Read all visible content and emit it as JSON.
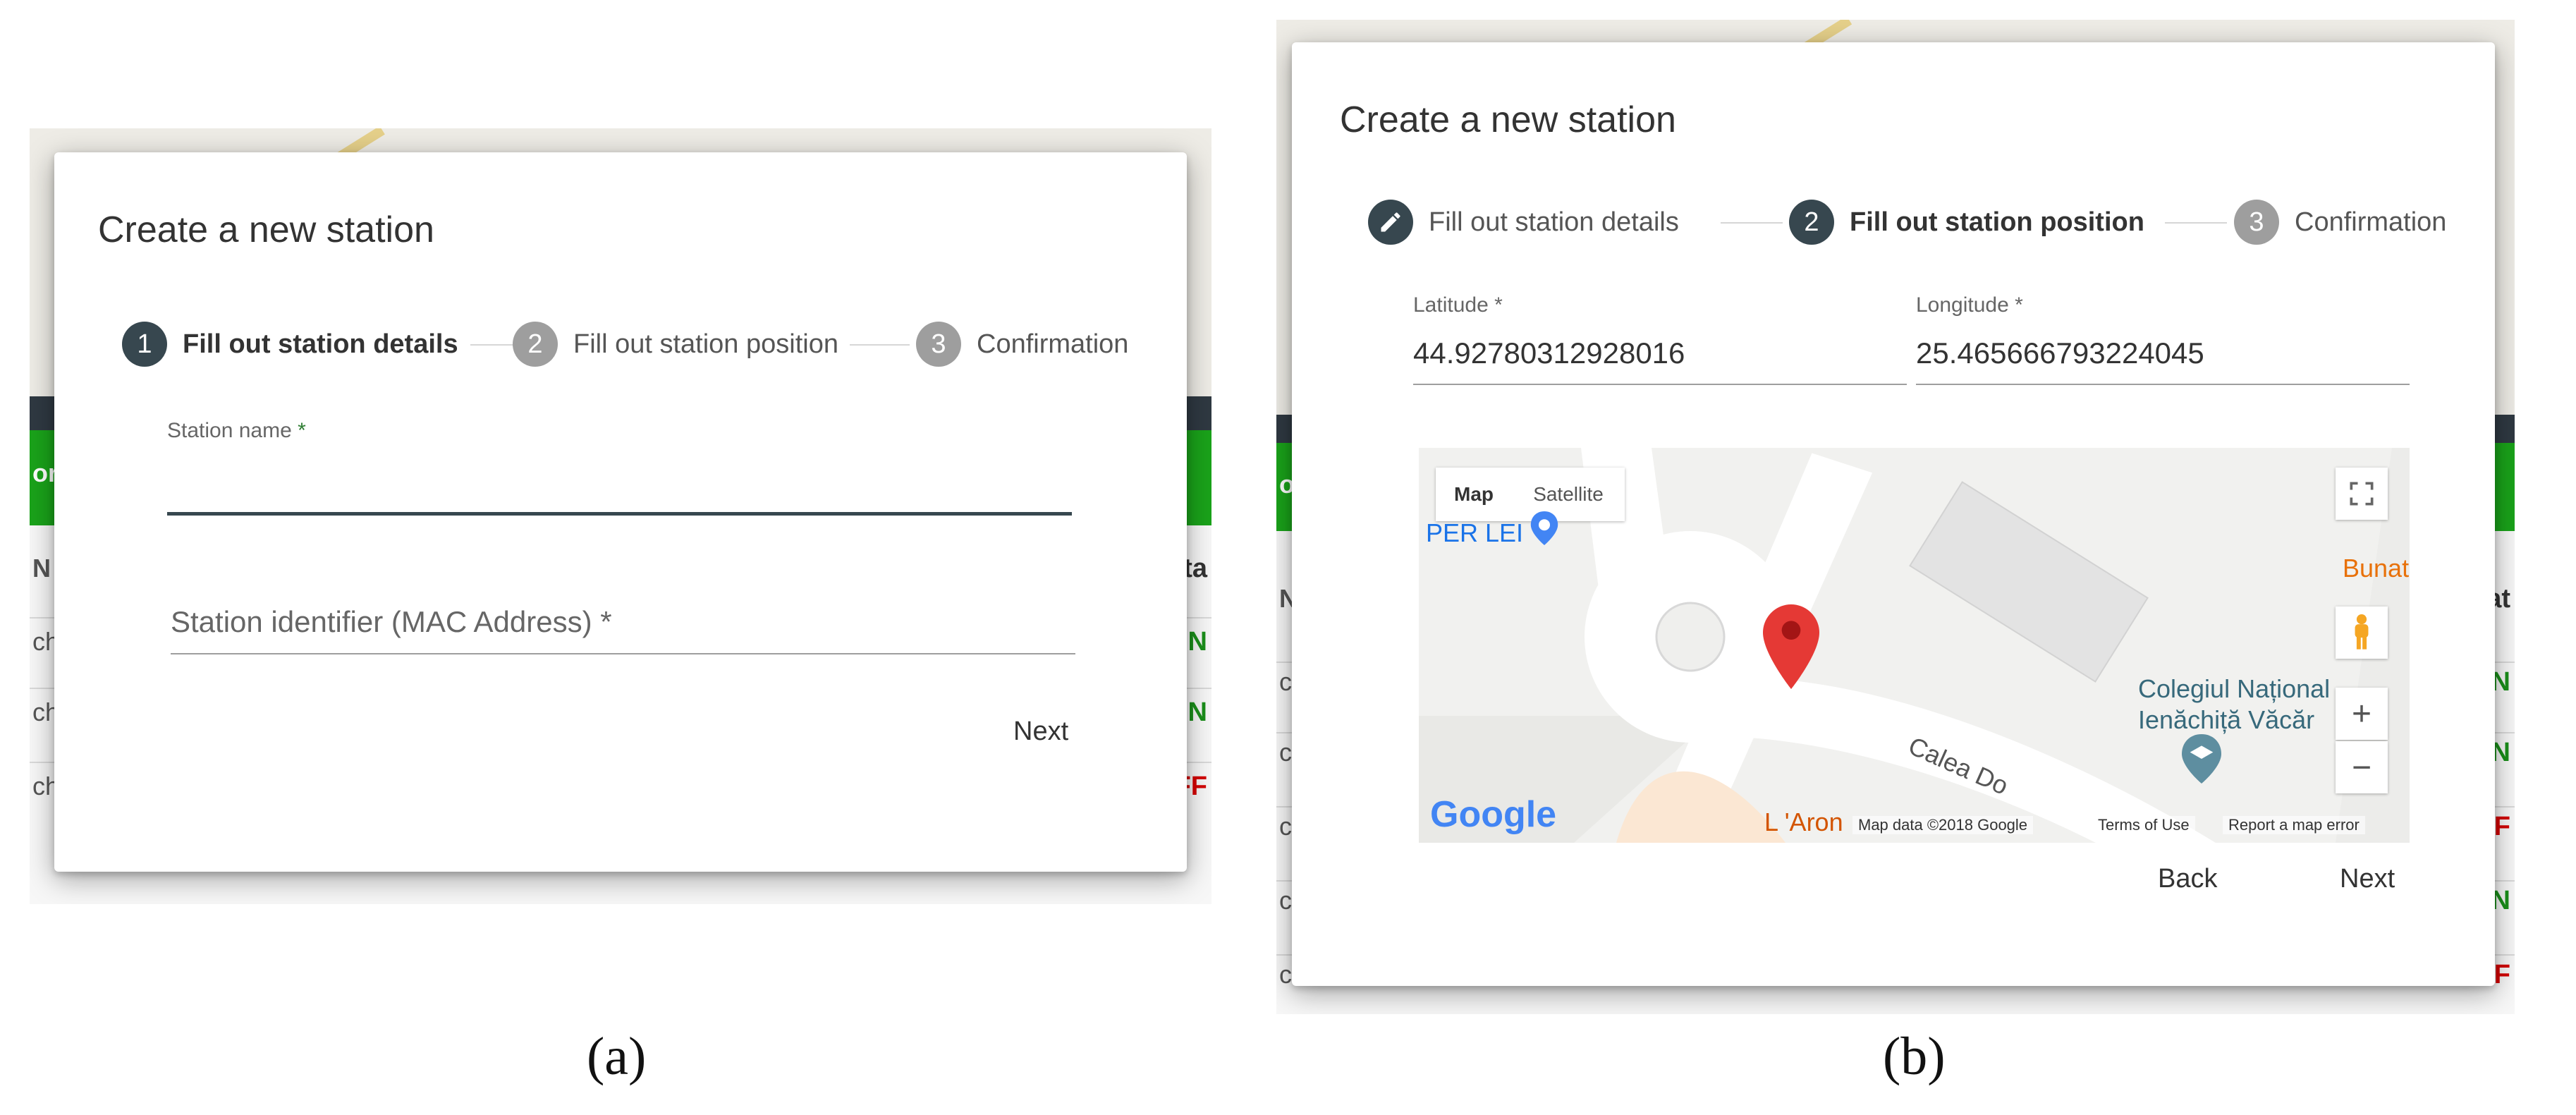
{
  "panel_a": {
    "dialog_title": "Create a new station",
    "steps": [
      {
        "number": "1",
        "label": "Fill out station details",
        "state": "active"
      },
      {
        "number": "2",
        "label": "Fill out station position",
        "state": "todo"
      },
      {
        "number": "3",
        "label": "Confirmation",
        "state": "todo"
      }
    ],
    "station_name_label": "Station name",
    "required_mark": "*",
    "station_name_value": "",
    "station_identifier_placeholder": "Station identifier (MAC Address) *",
    "next_label": "Next",
    "background_status": [
      "ON",
      "ON",
      "OFF"
    ],
    "background_row_letter": "ch",
    "background_header_left": "N",
    "background_header_right": "ta",
    "background_green_left": "or"
  },
  "panel_b": {
    "dialog_title": "Create a new station",
    "steps": [
      {
        "number": "",
        "label": "Fill out station details",
        "state": "done",
        "icon": "pencil-icon"
      },
      {
        "number": "2",
        "label": "Fill out station position",
        "state": "active"
      },
      {
        "number": "3",
        "label": "Confirmation",
        "state": "todo"
      }
    ],
    "latitude_label": "Latitude *",
    "latitude_value": "44.92780312928016",
    "longitude_label": "Longitude *",
    "longitude_value": "25.465666793224045",
    "map": {
      "type_map": "Map",
      "type_satellite": "Satellite",
      "label_per_lei": "PER LEI",
      "label_bunat": "Bunat",
      "label_colegiul_1": "Colegiul Național",
      "label_colegiul_2": "Ienăchiță Văcăr",
      "label_calea": "Calea Do",
      "label_aroma": "L 'Aron",
      "google_logo": "Google",
      "map_data": "Map data ©2018 Google",
      "terms": "Terms of Use",
      "report": "Report a map error",
      "zoom_in": "+",
      "zoom_out": "−"
    },
    "back_label": "Back",
    "next_label": "Next",
    "background_status": [
      "ON",
      "ON",
      "OFF",
      "ON",
      "OFF"
    ],
    "background_row_letter": "ch",
    "background_header_left": "N",
    "background_header_right": "tat",
    "background_green_left": "or"
  },
  "captions": {
    "a": "(a)",
    "b": "(b)"
  },
  "colors": {
    "active_step": "#37474f",
    "inactive_step": "#9e9e9e",
    "status_on": "#1a8f1a",
    "status_off": "#d40000",
    "pin": "#e53935",
    "google_blue": "#4285f4"
  }
}
